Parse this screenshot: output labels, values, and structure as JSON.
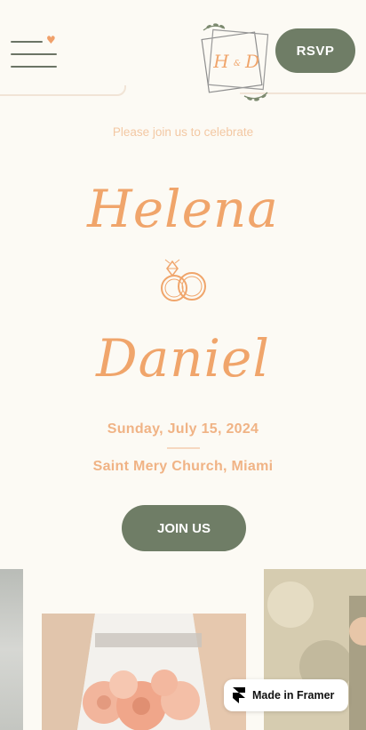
{
  "header": {
    "monogram": {
      "left_initial": "H",
      "ampersand": "&",
      "right_initial": "D"
    },
    "rsvp_label": "RSVP"
  },
  "hero": {
    "intro": "Please join us to celebrate",
    "bride_name": "Helena",
    "groom_name": "Daniel",
    "date": "Sunday, July 15, 2024",
    "venue": "Saint Mery Church, Miami",
    "join_label": "JOIN US"
  },
  "badge": {
    "label": "Made in Framer"
  },
  "icons": [
    "menu-icon",
    "heart-icon",
    "monogram-logo",
    "rings-icon",
    "framer-logo-icon"
  ],
  "colors": {
    "accent": "#f0a56b",
    "button": "#6f7d66",
    "background": "#fcfaf4",
    "text_light": "#f3c8a3"
  }
}
